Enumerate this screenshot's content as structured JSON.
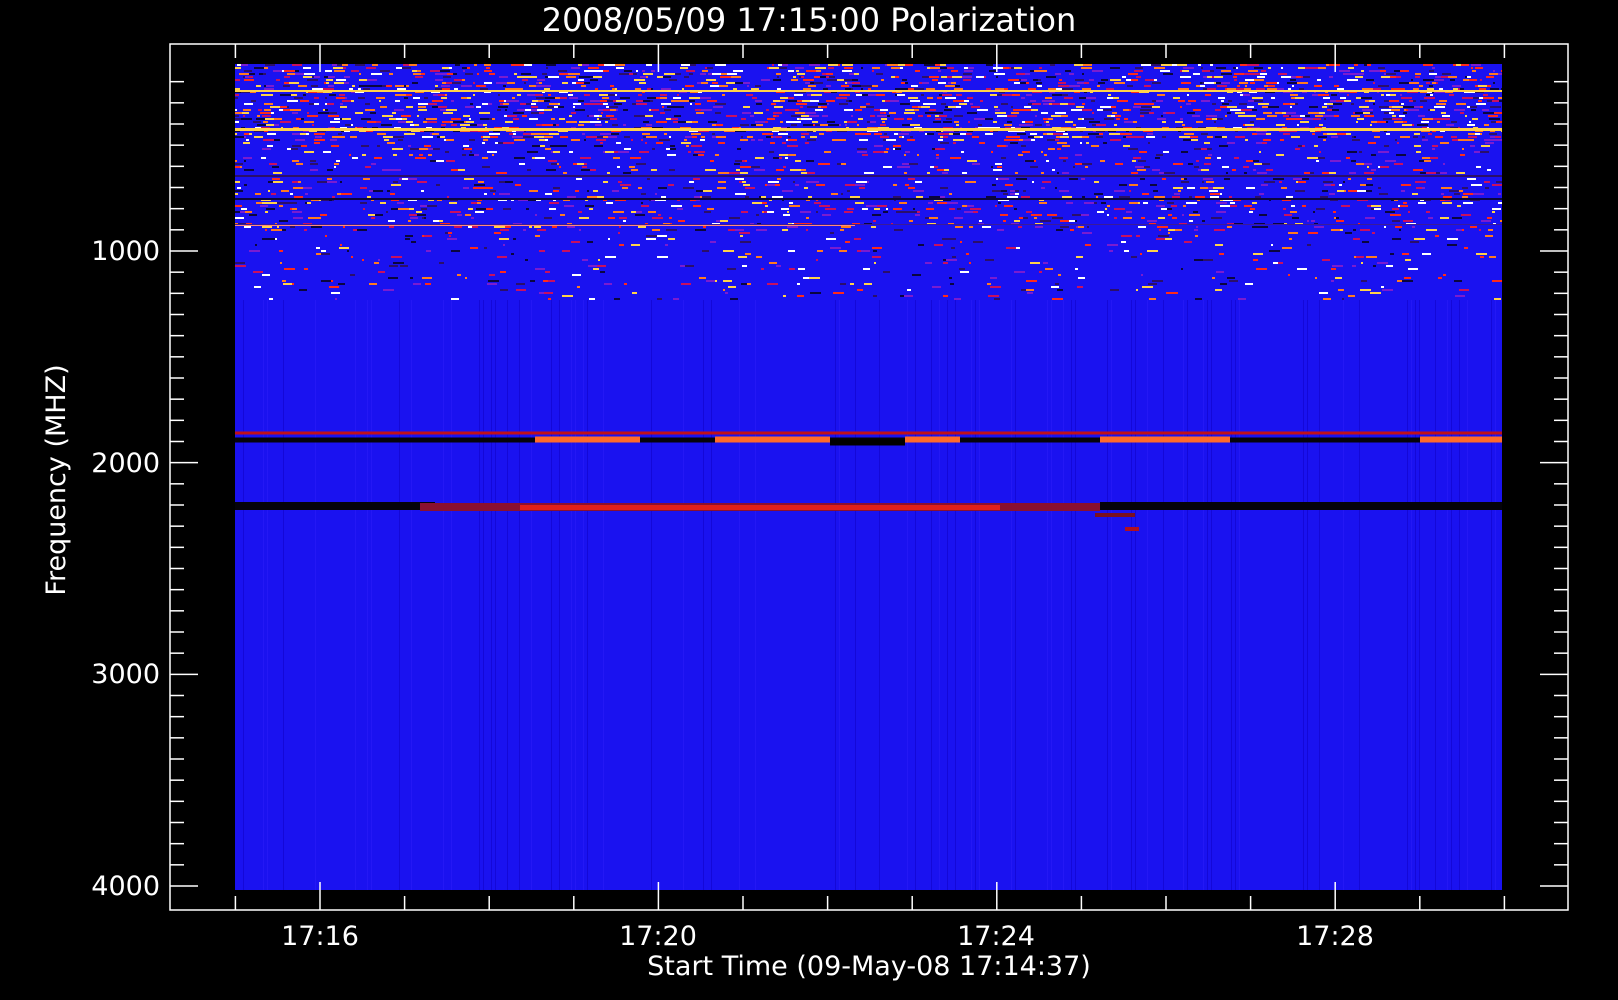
{
  "chart_data": {
    "type": "heatmap",
    "title": "2008/05/09 17:15:00 Polarization",
    "xlabel": "Start Time (09-May-08 17:14:37)",
    "ylabel": "Frequency (MHZ)",
    "x_tick_labels": [
      "17:16",
      "17:20",
      "17:24",
      "17:28"
    ],
    "y_tick_labels": [
      "1000",
      "2000",
      "3000",
      "4000"
    ],
    "y_ticks": [
      1000,
      2000,
      3000,
      4000
    ],
    "ylim": [
      4000,
      100
    ],
    "colors": {
      "background": "#000000",
      "map_base": "#1a12f0",
      "axes": "#ffffff"
    },
    "features": [
      {
        "name": "noisy low-frequency band",
        "freq_range": [
          100,
          1200
        ]
      },
      {
        "name": "strong line",
        "freq": 1900,
        "time_range": [
          "17:15",
          "17:30"
        ]
      },
      {
        "name": "dark/red band",
        "freq": 2200,
        "time_range": [
          "17:15",
          "17:30"
        ]
      }
    ]
  }
}
